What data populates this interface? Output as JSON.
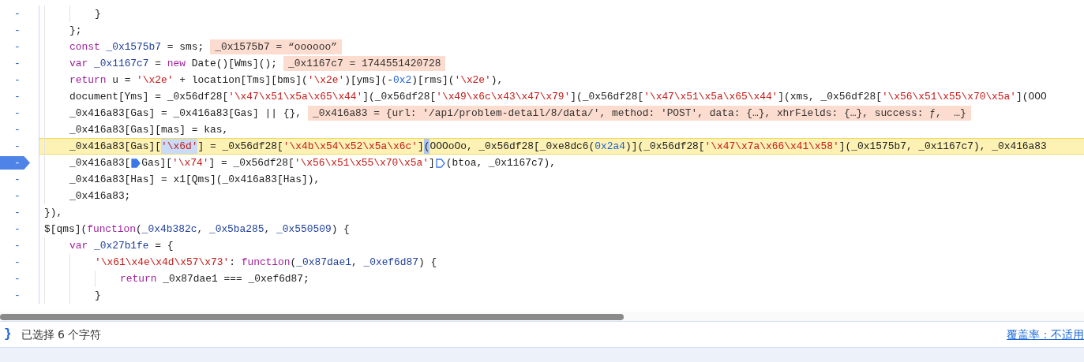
{
  "editor": {
    "lines": [
      {
        "gutter": "-",
        "current": false,
        "breakpoint": false,
        "tokens": [
          {
            "kind": "plain",
            "text": "        }"
          }
        ]
      },
      {
        "gutter": "-",
        "current": false,
        "breakpoint": false,
        "tokens": [
          {
            "kind": "plain",
            "text": "    };"
          }
        ]
      },
      {
        "gutter": "-",
        "current": false,
        "breakpoint": false,
        "tokens": [
          {
            "kind": "keyword",
            "text": "    const"
          },
          {
            "kind": "def",
            "text": " _0x1575b7"
          },
          {
            "kind": "plain",
            "text": " = sms;"
          },
          {
            "kind": "value",
            "text": "_0x1575b7 = “oooooo”"
          }
        ]
      },
      {
        "gutter": "-",
        "current": false,
        "breakpoint": false,
        "tokens": [
          {
            "kind": "keyword",
            "text": "    var"
          },
          {
            "kind": "def",
            "text": " _0x1167c7"
          },
          {
            "kind": "plain",
            "text": " = "
          },
          {
            "kind": "keyword",
            "text": "new"
          },
          {
            "kind": "plain",
            "text": " Date()[Wms]();"
          },
          {
            "kind": "value",
            "text": "_0x1167c7 = 1744551420728"
          }
        ]
      },
      {
        "gutter": "-",
        "current": false,
        "breakpoint": false,
        "tokens": [
          {
            "kind": "keyword",
            "text": "    return"
          },
          {
            "kind": "plain",
            "text": " u = "
          },
          {
            "kind": "string",
            "text": "'\\x2e'"
          },
          {
            "kind": "plain",
            "text": " + location[Tms][bms]("
          },
          {
            "kind": "string",
            "text": "'\\x2e'"
          },
          {
            "kind": "plain",
            "text": ")[yms](-"
          },
          {
            "kind": "number",
            "text": "0x2"
          },
          {
            "kind": "plain",
            "text": ")[rms]("
          },
          {
            "kind": "string",
            "text": "'\\x2e'"
          },
          {
            "kind": "plain",
            "text": "),"
          }
        ]
      },
      {
        "gutter": "-",
        "current": false,
        "breakpoint": false,
        "tokens": [
          {
            "kind": "plain",
            "text": "    document[Yms] = _0x56df28["
          },
          {
            "kind": "string",
            "text": "'\\x47\\x51\\x5a\\x65\\x44'"
          },
          {
            "kind": "plain",
            "text": "](_0x56df28["
          },
          {
            "kind": "string",
            "text": "'\\x49\\x6c\\x43\\x47\\x79'"
          },
          {
            "kind": "plain",
            "text": "](_0x56df28["
          },
          {
            "kind": "string",
            "text": "'\\x47\\x51\\x5a\\x65\\x44'"
          },
          {
            "kind": "plain",
            "text": "](xms, _0x56df28["
          },
          {
            "kind": "string",
            "text": "'\\x56\\x51\\x55\\x70\\x5a'"
          },
          {
            "kind": "plain",
            "text": "](OOO"
          }
        ]
      },
      {
        "gutter": "-",
        "current": false,
        "breakpoint": false,
        "tokens": [
          {
            "kind": "plain",
            "text": "    _0x416a83[Gas] = _0x416a83[Gas] || {},"
          },
          {
            "kind": "value",
            "text": "_0x416a83 = {url: '/api/problem-detail/8/data/', method: 'POST', data: {…}, xhrFields: {…}, success: ƒ,  …}"
          }
        ]
      },
      {
        "gutter": "-",
        "current": false,
        "breakpoint": false,
        "tokens": [
          {
            "kind": "plain",
            "text": "    _0x416a83[Gas][mas] = kas,"
          }
        ]
      },
      {
        "gutter": "-",
        "current": true,
        "breakpoint": false,
        "tokens": [
          {
            "kind": "plain",
            "text": "    _0x416a83[Gas]["
          },
          {
            "kind": "selection",
            "text": "'\\x6d'"
          },
          {
            "kind": "plain",
            "text": "] = _0x56df28["
          },
          {
            "kind": "string",
            "text": "'\\x4b\\x54\\x52\\x5a\\x6c'"
          },
          {
            "kind": "plain",
            "text": "]"
          },
          {
            "kind": "bracket",
            "text": "("
          },
          {
            "kind": "plain",
            "text": "OOOoOo, _0x56df28[_0xe8dc6("
          },
          {
            "kind": "number",
            "text": "0x2a4"
          },
          {
            "kind": "plain",
            "text": ")](_0x56df28["
          },
          {
            "kind": "string",
            "text": "'\\x47\\x7a\\x66\\x41\\x58'"
          },
          {
            "kind": "plain",
            "text": "](_0x1575b7, _0x1167c7), _0x416a83"
          }
        ]
      },
      {
        "gutter": "-",
        "current": false,
        "breakpoint": true,
        "tokens": [
          {
            "kind": "plain",
            "text": "    _0x416a83["
          },
          {
            "kind": "bp-filled"
          },
          {
            "kind": "plain",
            "text": "Gas]["
          },
          {
            "kind": "string",
            "text": "'\\x74'"
          },
          {
            "kind": "plain",
            "text": "] = _0x56df28["
          },
          {
            "kind": "string",
            "text": "'\\x56\\x51\\x55\\x70\\x5a'"
          },
          {
            "kind": "plain",
            "text": "]"
          },
          {
            "kind": "bp-outline"
          },
          {
            "kind": "plain",
            "text": "(btoa, _0x1167c7),"
          }
        ]
      },
      {
        "gutter": "-",
        "current": false,
        "breakpoint": false,
        "tokens": [
          {
            "kind": "plain",
            "text": "    _0x416a83[Has] = x1[Qms](_0x416a83[Has]),"
          }
        ]
      },
      {
        "gutter": "-",
        "current": false,
        "breakpoint": false,
        "tokens": [
          {
            "kind": "plain",
            "text": "    _0x416a83;"
          }
        ]
      },
      {
        "gutter": "-",
        "current": false,
        "breakpoint": false,
        "tokens": [
          {
            "kind": "plain",
            "text": "}),"
          }
        ]
      },
      {
        "gutter": "-",
        "current": false,
        "breakpoint": false,
        "tokens": [
          {
            "kind": "plain",
            "text": "$[qms]("
          },
          {
            "kind": "keyword",
            "text": "function"
          },
          {
            "kind": "plain",
            "text": "("
          },
          {
            "kind": "def",
            "text": "_0x4b382c"
          },
          {
            "kind": "plain",
            "text": ", "
          },
          {
            "kind": "def",
            "text": "_0x5ba285"
          },
          {
            "kind": "plain",
            "text": ", "
          },
          {
            "kind": "def",
            "text": "_0x550509"
          },
          {
            "kind": "plain",
            "text": ") {"
          }
        ]
      },
      {
        "gutter": "-",
        "current": false,
        "breakpoint": false,
        "tokens": [
          {
            "kind": "keyword",
            "text": "    var"
          },
          {
            "kind": "def",
            "text": " _0x27b1fe"
          },
          {
            "kind": "plain",
            "text": " = {"
          }
        ]
      },
      {
        "gutter": "-",
        "current": false,
        "breakpoint": false,
        "tokens": [
          {
            "kind": "string",
            "text": "        '\\x61\\x4e\\x4d\\x57\\x73'"
          },
          {
            "kind": "plain",
            "text": ": "
          },
          {
            "kind": "keyword",
            "text": "function"
          },
          {
            "kind": "plain",
            "text": "("
          },
          {
            "kind": "def",
            "text": "_0x87dae1"
          },
          {
            "kind": "plain",
            "text": ", "
          },
          {
            "kind": "def",
            "text": "_0xef6d87"
          },
          {
            "kind": "plain",
            "text": ") {"
          }
        ]
      },
      {
        "gutter": "-",
        "current": false,
        "breakpoint": false,
        "tokens": [
          {
            "kind": "keyword",
            "text": "            return"
          },
          {
            "kind": "plain",
            "text": " _0x87dae1 === _0xef6d87;"
          }
        ]
      },
      {
        "gutter": "-",
        "current": false,
        "breakpoint": false,
        "tokens": [
          {
            "kind": "plain",
            "text": "        }"
          }
        ]
      }
    ]
  },
  "status_bar": {
    "format_button": "}",
    "selection_info": "已选择 6 个字符",
    "coverage": "覆盖率：不适用"
  }
}
